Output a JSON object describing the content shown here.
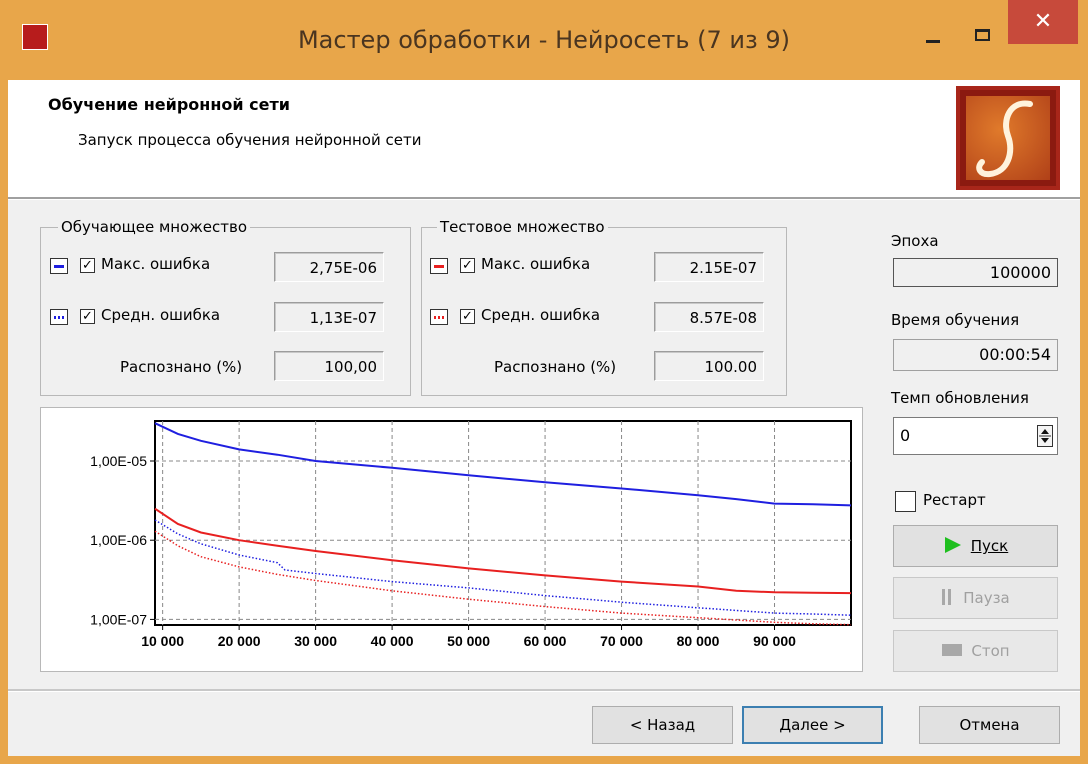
{
  "window": {
    "title": "Мастер обработки - Нейросеть (7 из 9)",
    "close_glyph": "✕"
  },
  "header": {
    "title": "Обучение нейронной сети",
    "subtitle": "Запуск процесса обучения нейронной сети",
    "logo_icon": "deductor-logo-icon"
  },
  "training_set": {
    "label": "Обучающее множество",
    "max_error_label": "Макс. ошибка",
    "max_error_value": "2,75E-06",
    "max_error_checked": true,
    "avg_error_label": "Средн. ошибка",
    "avg_error_value": "1,13E-07",
    "avg_error_checked": true,
    "recognized_label": "Распознано (%)",
    "recognized_value": "100,00"
  },
  "test_set": {
    "label": "Тестовое множество",
    "max_error_label": "Макс. ошибка",
    "max_error_value": "2.15E-07",
    "max_error_checked": true,
    "avg_error_label": "Средн. ошибка",
    "avg_error_value": "8.57E-08",
    "avg_error_checked": true,
    "recognized_label": "Распознано (%)",
    "recognized_value": "100.00"
  },
  "side": {
    "epoch_label": "Эпоха",
    "epoch_value": "100000",
    "time_label": "Время обучения",
    "time_value": "00:00:54",
    "rate_label": "Темп обновления",
    "rate_value": "0",
    "restart_label": "Рестарт",
    "restart_checked": false,
    "start_label": "Пуск",
    "pause_label": "Пауза",
    "stop_label": "Стоп"
  },
  "footer": {
    "back_label": "< Назад",
    "next_label": "Далее >",
    "cancel_label": "Отмена"
  },
  "colors": {
    "titlebar": "#e8a64a",
    "close": "#c74a3b",
    "train_series": "#1f1fe0",
    "test_series": "#e82020",
    "start_icon": "#1fbf1f"
  },
  "chart_data": {
    "type": "line",
    "x_scale": "linear",
    "y_scale": "log",
    "xlim": [
      9000,
      100000
    ],
    "ylim": [
      8.5e-08,
      3.2e-05
    ],
    "x_ticks": [
      10000,
      20000,
      30000,
      40000,
      50000,
      60000,
      70000,
      80000,
      90000
    ],
    "x_tick_labels": [
      "10 000",
      "20 000",
      "30 000",
      "40 000",
      "50 000",
      "60 000",
      "70 000",
      "80 000",
      "90 000"
    ],
    "y_ticks": [
      1e-05,
      1e-06,
      1e-07
    ],
    "y_tick_labels": [
      "1,00E-05",
      "1,00E-06",
      "1,00E-07"
    ],
    "grid": true,
    "series": [
      {
        "color": "#1f1fe0",
        "style": "solid",
        "x": [
          9000,
          12000,
          15000,
          20000,
          25000,
          30000,
          40000,
          50000,
          60000,
          70000,
          80000,
          85000,
          90000,
          95000,
          100000
        ],
        "y": [
          3e-05,
          2.2e-05,
          1.8e-05,
          1.4e-05,
          1.2e-05,
          1e-05,
          8.2e-06,
          6.6e-06,
          5.4e-06,
          4.5e-06,
          3.7e-06,
          3.3e-06,
          2.9e-06,
          2.85e-06,
          2.75e-06
        ]
      },
      {
        "color": "#1f1fe0",
        "style": "dotted",
        "x": [
          9000,
          12000,
          15000,
          20000,
          25000,
          26000,
          30000,
          40000,
          50000,
          60000,
          70000,
          80000,
          90000,
          95000,
          100000
        ],
        "y": [
          1.8e-06,
          1.2e-06,
          9e-07,
          6.5e-07,
          5.2e-07,
          4.2e-07,
          3.8e-07,
          3e-07,
          2.5e-07,
          2e-07,
          1.65e-07,
          1.4e-07,
          1.2e-07,
          1.17e-07,
          1.13e-07
        ]
      },
      {
        "color": "#e82020",
        "style": "solid",
        "x": [
          9000,
          12000,
          15000,
          20000,
          25000,
          30000,
          40000,
          50000,
          60000,
          70000,
          80000,
          85000,
          90000,
          95000,
          100000
        ],
        "y": [
          2.5e-06,
          1.6e-06,
          1.25e-06,
          1e-06,
          8.5e-07,
          7.3e-07,
          5.6e-07,
          4.4e-07,
          3.6e-07,
          3e-07,
          2.6e-07,
          2.3e-07,
          2.2e-07,
          2.17e-07,
          2.15e-07
        ]
      },
      {
        "color": "#e82020",
        "style": "dotted",
        "x": [
          9000,
          12000,
          15000,
          20000,
          25000,
          30000,
          40000,
          50000,
          60000,
          70000,
          80000,
          90000,
          95000,
          100000
        ],
        "y": [
          1.3e-06,
          8.5e-07,
          6.2e-07,
          4.6e-07,
          3.7e-07,
          3.1e-07,
          2.3e-07,
          1.8e-07,
          1.45e-07,
          1.2e-07,
          1.05e-07,
          9.2e-08,
          8.8e-08,
          8.57e-08
        ]
      }
    ]
  }
}
